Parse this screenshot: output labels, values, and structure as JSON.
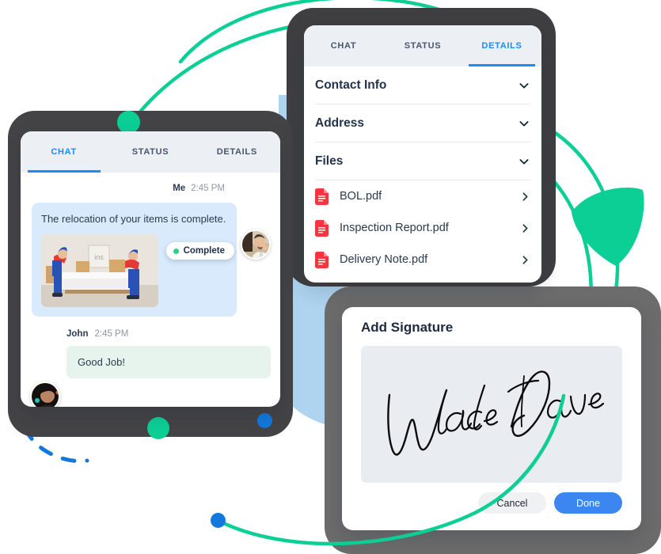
{
  "details_panel": {
    "name": "Details panel",
    "tabs": [
      {
        "label": "CHAT",
        "active": false
      },
      {
        "label": "STATUS",
        "active": false
      },
      {
        "label": "DETAILS",
        "active": true
      }
    ],
    "sections": [
      {
        "title": "Contact Info",
        "icon": "chevron-down-icon"
      },
      {
        "title": "Address",
        "icon": "chevron-down-icon"
      },
      {
        "title": "Files",
        "icon": "chevron-down-icon"
      }
    ],
    "files": [
      {
        "name": "BOL.pdf",
        "icon": "pdf-file-icon",
        "chevron": "chevron-right-icon"
      },
      {
        "name": "Inspection Report.pdf",
        "icon": "pdf-file-icon",
        "chevron": "chevron-right-icon"
      },
      {
        "name": "Delivery Note.pdf",
        "icon": "pdf-file-icon",
        "chevron": "chevron-right-icon"
      }
    ]
  },
  "chat_panel": {
    "name": "Chat panel",
    "tabs": [
      {
        "label": "CHAT",
        "active": true
      },
      {
        "label": "STATUS",
        "active": false
      },
      {
        "label": "DETAILS",
        "active": false
      }
    ],
    "messages": [
      {
        "sender": "Me",
        "time": "2:45 PM",
        "status_badge": "Complete",
        "text": "The relocation of your items is complete.",
        "attachment": "movers-carrying-sofa-photo",
        "avatar": "avatar-me"
      },
      {
        "sender": "John",
        "time": "2:45 PM",
        "text": "Good Job!",
        "avatar": "avatar-john"
      }
    ]
  },
  "signature_panel": {
    "name": "Add Signature dialog",
    "title": "Add Signature",
    "signature_value": "Wade Dave",
    "buttons": {
      "cancel": "Cancel",
      "done": "Done"
    }
  },
  "colors": {
    "accent_blue": "#1b8cf3",
    "primary_button": "#3b86f0",
    "accent_green": "#0ccf96",
    "status_green": "#2ed08a",
    "pdf_red": "#f8353e",
    "frame_dark": "#3f3f41",
    "frame_gray": "#6c6c6c",
    "blob_blue": "#aed4f0",
    "bubble_me": "#d9eafc",
    "bubble_other": "#e6f4ed",
    "tabbar_bg": "#eceff4",
    "text_dark": "#23334a"
  }
}
